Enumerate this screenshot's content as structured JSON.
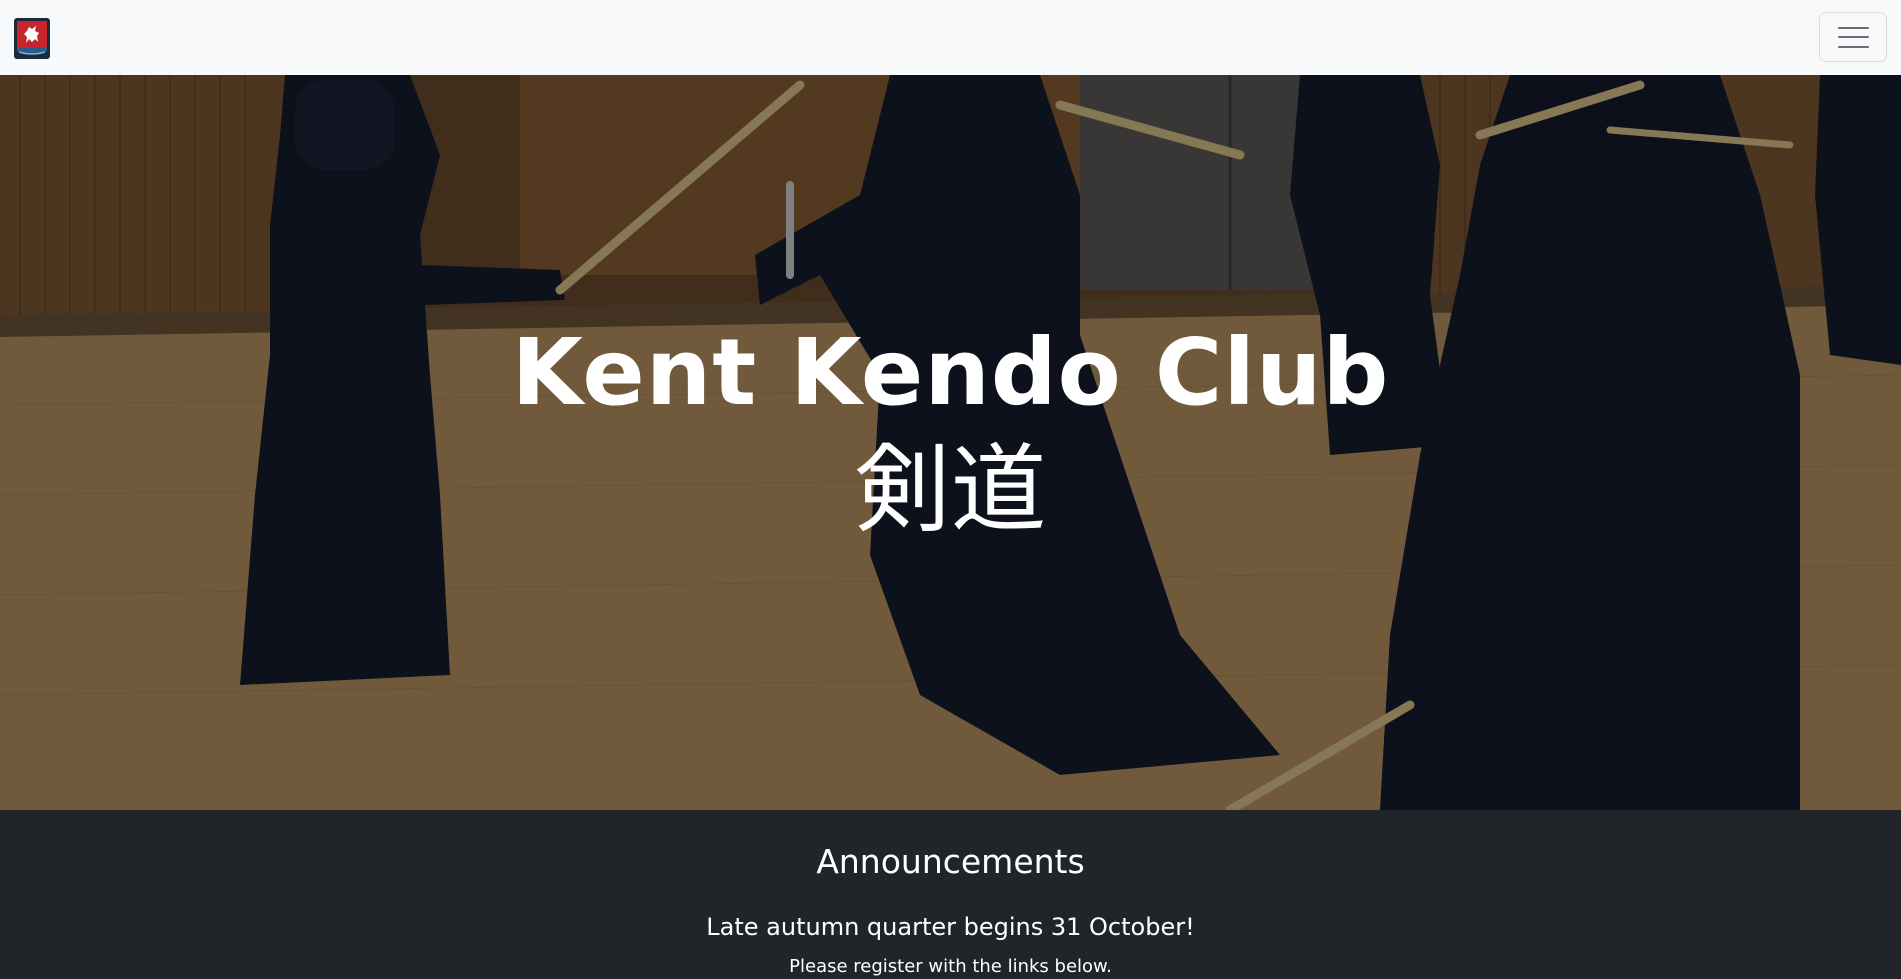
{
  "navbar": {
    "logo_icon": "club-crest-icon",
    "menu_icon": "hamburger-menu-icon"
  },
  "hero": {
    "title": "Kent Kendo Club",
    "subtitle": "剣道"
  },
  "announcements": {
    "heading": "Announcements",
    "items": [
      {
        "title": "Late autumn quarter begins 31 October!",
        "text": "Please register with the links below."
      }
    ]
  },
  "colors": {
    "navbar_bg": "#f8f9fa",
    "dark_section_bg": "#212529",
    "crest_red": "#c8242b",
    "crest_blue": "#2a5a8c"
  }
}
